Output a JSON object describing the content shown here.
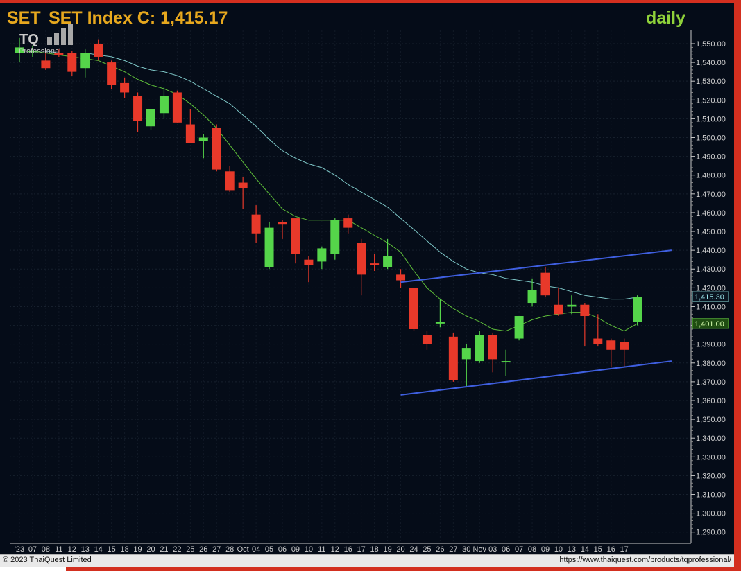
{
  "header": {
    "symbol_text": "SET",
    "title_text": "SET Index C: 1,415.17",
    "period": "daily",
    "logo_text": "TQ",
    "logo_sub": "Professional"
  },
  "footer": {
    "copyright": "© 2023 ThaiQuest Limited",
    "url": "https://www.thaiquest.com/products/tqprofessional/"
  },
  "colors": {
    "background": "#050c18",
    "up_candle": "#55d54a",
    "down_candle": "#e8392a",
    "ma_short": "#5fbf3a",
    "ma_long": "#7fc8c8",
    "channel": "#3f5fe0",
    "title": "#e7a81e",
    "period": "#8fd13a"
  },
  "chart_data": {
    "type": "candlestick",
    "title": "SET Index C: 1,415.17",
    "ylim": [
      1284,
      1557
    ],
    "y_ticks": [
      1290,
      1300,
      1310,
      1320,
      1330,
      1340,
      1350,
      1360,
      1370,
      1380,
      1390,
      1400,
      1410,
      1420,
      1430,
      1440,
      1450,
      1460,
      1470,
      1480,
      1490,
      1500,
      1510,
      1520,
      1530,
      1540,
      1550
    ],
    "x_labels": [
      "'23",
      "07",
      "08",
      "11",
      "12",
      "13",
      "14",
      "15",
      "18",
      "19",
      "20",
      "21",
      "22",
      "25",
      "26",
      "27",
      "28",
      "Oct",
      "04",
      "05",
      "06",
      "09",
      "10",
      "11",
      "12",
      "16",
      "17",
      "18",
      "19",
      "20",
      "24",
      "25",
      "26",
      "27",
      "30",
      "Nov",
      "03",
      "06",
      "07",
      "08",
      "09",
      "10",
      "13",
      "14",
      "15",
      "16",
      "17"
    ],
    "candles": [
      {
        "o": 1545,
        "h": 1553,
        "l": 1540,
        "c": 1548
      },
      {
        "o": 1546,
        "h": 1549,
        "l": 1543,
        "c": 1546
      },
      {
        "o": 1541,
        "h": 1547,
        "l": 1536,
        "c": 1537
      },
      {
        "o": 1545,
        "h": 1547,
        "l": 1543,
        "c": 1544
      },
      {
        "o": 1545,
        "h": 1546,
        "l": 1533,
        "c": 1535
      },
      {
        "o": 1537,
        "h": 1547,
        "l": 1532,
        "c": 1545
      },
      {
        "o": 1550,
        "h": 1552,
        "l": 1541,
        "c": 1543
      },
      {
        "o": 1540,
        "h": 1541,
        "l": 1526,
        "c": 1528
      },
      {
        "o": 1529,
        "h": 1532,
        "l": 1521,
        "c": 1524
      },
      {
        "o": 1522,
        "h": 1524,
        "l": 1503,
        "c": 1509
      },
      {
        "o": 1506,
        "h": 1515,
        "l": 1504,
        "c": 1515
      },
      {
        "o": 1513,
        "h": 1527,
        "l": 1510,
        "c": 1522
      },
      {
        "o": 1524,
        "h": 1525,
        "l": 1508,
        "c": 1508
      },
      {
        "o": 1507,
        "h": 1515,
        "l": 1497,
        "c": 1497
      },
      {
        "o": 1498,
        "h": 1502,
        "l": 1489,
        "c": 1500
      },
      {
        "o": 1505,
        "h": 1507,
        "l": 1482,
        "c": 1483
      },
      {
        "o": 1482,
        "h": 1485,
        "l": 1471,
        "c": 1472
      },
      {
        "o": 1476,
        "h": 1479,
        "l": 1462,
        "c": 1473
      },
      {
        "o": 1459,
        "h": 1464,
        "l": 1444,
        "c": 1449
      },
      {
        "o": 1431,
        "h": 1455,
        "l": 1430,
        "c": 1452
      },
      {
        "o": 1455,
        "h": 1456,
        "l": 1446,
        "c": 1454
      },
      {
        "o": 1457,
        "h": 1457,
        "l": 1433,
        "c": 1438
      },
      {
        "o": 1435,
        "h": 1437,
        "l": 1423,
        "c": 1432
      },
      {
        "o": 1434,
        "h": 1442,
        "l": 1430,
        "c": 1441
      },
      {
        "o": 1438,
        "h": 1457,
        "l": 1435,
        "c": 1456
      },
      {
        "o": 1457,
        "h": 1459,
        "l": 1449,
        "c": 1452
      },
      {
        "o": 1444,
        "h": 1446,
        "l": 1416,
        "c": 1427
      },
      {
        "o": 1433,
        "h": 1438,
        "l": 1429,
        "c": 1432
      },
      {
        "o": 1431,
        "h": 1446,
        "l": 1430,
        "c": 1437
      },
      {
        "o": 1427,
        "h": 1430,
        "l": 1420,
        "c": 1424
      },
      {
        "o": 1420,
        "h": 1420,
        "l": 1397,
        "c": 1398
      },
      {
        "o": 1395,
        "h": 1397,
        "l": 1387,
        "c": 1390
      },
      {
        "o": 1401,
        "h": 1414,
        "l": 1399,
        "c": 1402
      },
      {
        "o": 1394,
        "h": 1396,
        "l": 1370,
        "c": 1371
      },
      {
        "o": 1382,
        "h": 1390,
        "l": 1367,
        "c": 1388
      },
      {
        "o": 1381,
        "h": 1397,
        "l": 1380,
        "c": 1395
      },
      {
        "o": 1395,
        "h": 1396,
        "l": 1375,
        "c": 1382
      },
      {
        "o": 1381,
        "h": 1387,
        "l": 1373,
        "c": 1381
      },
      {
        "o": 1393,
        "h": 1405,
        "l": 1392,
        "c": 1405
      },
      {
        "o": 1412,
        "h": 1425,
        "l": 1410,
        "c": 1419
      },
      {
        "o": 1428,
        "h": 1431,
        "l": 1415,
        "c": 1416
      },
      {
        "o": 1411,
        "h": 1420,
        "l": 1405,
        "c": 1406
      },
      {
        "o": 1410,
        "h": 1416,
        "l": 1406,
        "c": 1411
      },
      {
        "o": 1411,
        "h": 1412,
        "l": 1389,
        "c": 1405
      },
      {
        "o": 1393,
        "h": 1406,
        "l": 1389,
        "c": 1390
      },
      {
        "o": 1392,
        "h": 1393,
        "l": 1378,
        "c": 1387
      },
      {
        "o": 1391,
        "h": 1393,
        "l": 1378,
        "c": 1387
      },
      {
        "o": 1402,
        "h": 1416,
        "l": 1400,
        "c": 1415
      }
    ],
    "ma_short": [
      1546,
      1546,
      1545,
      1544,
      1543,
      1542,
      1541,
      1538,
      1535,
      1531,
      1528,
      1526,
      1523,
      1518,
      1512,
      1505,
      1496,
      1487,
      1478,
      1470,
      1462,
      1458,
      1456,
      1456,
      1456,
      1456,
      1452,
      1448,
      1444,
      1439,
      1429,
      1420,
      1414,
      1409,
      1405,
      1402,
      1398,
      1397,
      1400,
      1403,
      1405,
      1406,
      1407,
      1407,
      1404,
      1400,
      1397,
      1401
    ],
    "ma_long": [
      1546,
      1546,
      1546,
      1545,
      1545,
      1545,
      1544,
      1543,
      1541,
      1538,
      1536,
      1535,
      1533,
      1530,
      1526,
      1522,
      1518,
      1512,
      1506,
      1499,
      1493,
      1489,
      1486,
      1484,
      1480,
      1475,
      1471,
      1467,
      1463,
      1457,
      1451,
      1445,
      1439,
      1434,
      1430,
      1428,
      1427,
      1425,
      1424,
      1423,
      1421,
      1420,
      1418,
      1416,
      1415,
      1414,
      1414,
      1415
    ],
    "channel_lines": [
      {
        "from": {
          "index": 29,
          "value": 1423
        },
        "to": {
          "index": 49.6,
          "value": 1440
        }
      },
      {
        "from": {
          "index": 29,
          "value": 1363
        },
        "to": {
          "index": 49.6,
          "value": 1381
        }
      }
    ],
    "price_tags": [
      {
        "value": 1415.3,
        "label": "1,415.30",
        "style": "cyan"
      },
      {
        "value": 1401.0,
        "label": "1,401.00",
        "style": "green"
      }
    ]
  }
}
